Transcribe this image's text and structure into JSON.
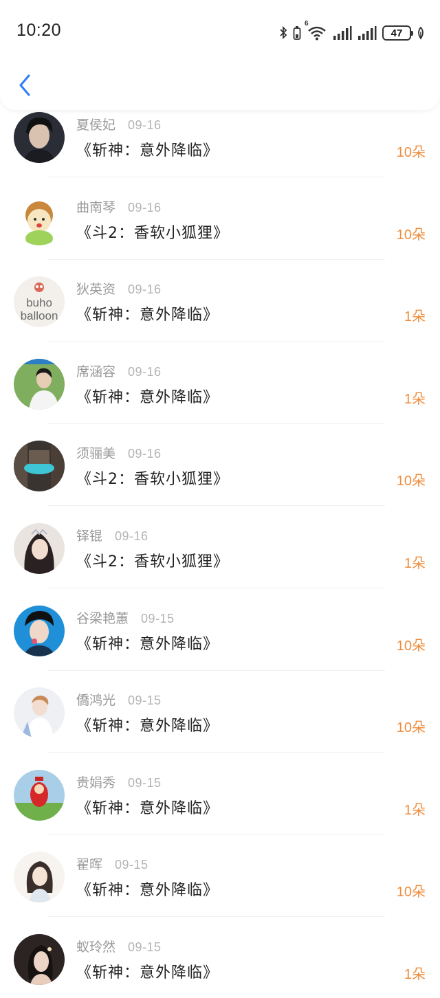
{
  "status_bar": {
    "time": "10:20",
    "network_label": "6",
    "battery": "47"
  },
  "colors": {
    "accent_blue": "#2d7df6",
    "amount_orange": "#ef8c3c",
    "name_gray": "#999999"
  },
  "records": [
    {
      "name": "夏侯妃",
      "date": "09-16",
      "title": "《斩神：意外降临》",
      "amount": "10朵",
      "avatar": "avatar-man-dark"
    },
    {
      "name": "曲南琴",
      "date": "09-16",
      "title": "《斗2：香软小狐狸》",
      "amount": "10朵",
      "avatar": "avatar-cartoon"
    },
    {
      "name": "狄英资",
      "date": "09-16",
      "title": "《斩神：意外降临》",
      "amount": "1朵",
      "avatar": "avatar-buho"
    },
    {
      "name": "席涵容",
      "date": "09-16",
      "title": "《斩神：意外降临》",
      "amount": "1朵",
      "avatar": "avatar-man-outdoor"
    },
    {
      "name": "须骊美",
      "date": "09-16",
      "title": "《斗2：香软小狐狸》",
      "amount": "10朵",
      "avatar": "avatar-city"
    },
    {
      "name": "铎锟",
      "date": "09-16",
      "title": "《斗2：香软小狐狸》",
      "amount": "1朵",
      "avatar": "avatar-girl-crown"
    },
    {
      "name": "谷梁艳蕙",
      "date": "09-15",
      "title": "《斩神：意外降临》",
      "amount": "10朵",
      "avatar": "avatar-boy-blue"
    },
    {
      "name": "僑鸿光",
      "date": "09-15",
      "title": "《斩神：意外降临》",
      "amount": "10朵",
      "avatar": "avatar-boy-white"
    },
    {
      "name": "贵娟秀",
      "date": "09-15",
      "title": "《斩神：意外降临》",
      "amount": "1朵",
      "avatar": "avatar-teletubby"
    },
    {
      "name": "翟晖",
      "date": "09-15",
      "title": "《斩神：意外降临》",
      "amount": "10朵",
      "avatar": "avatar-girl-drawing"
    },
    {
      "name": "蚁玲然",
      "date": "09-15",
      "title": "《斩神：意外降临》",
      "amount": "1朵",
      "avatar": "avatar-girl-flower"
    }
  ],
  "avatar_text": {
    "buho_line1": "buho",
    "buho_line2": "balloon"
  }
}
